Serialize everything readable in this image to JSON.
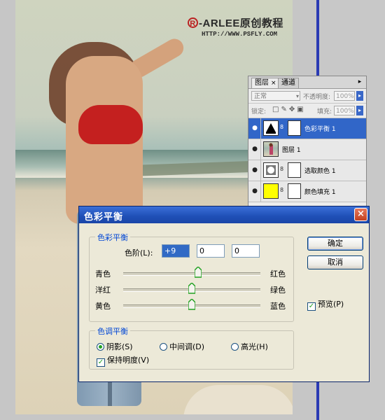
{
  "watermark": {
    "brand": "-ARLEE原创教程",
    "url": "HTTP://WWW.PSFLY.COM",
    "reg_symbol": "R"
  },
  "layers_panel": {
    "tabs": [
      {
        "label": "图层",
        "close": "×"
      },
      {
        "label": "通道"
      }
    ],
    "blend_mode": "正常",
    "opacity_label": "不透明度:",
    "opacity_value": "100%",
    "lock_label": "锁定:",
    "fill_label": "填充:",
    "fill_value": "100%",
    "layers": [
      {
        "name": "色彩平衡 1",
        "selected": true
      },
      {
        "name": "图层 1",
        "selected": false
      },
      {
        "name": "选取颜色 1",
        "selected": false
      },
      {
        "name": "颜色填充 1",
        "selected": false
      }
    ],
    "colors": {
      "selected": "#3166c8",
      "fill_swatch": "#ffff00"
    }
  },
  "dialog": {
    "title": "色彩平衡",
    "close_icon": "×",
    "balance_group": {
      "legend": "色彩平衡",
      "levels_label": "色阶(L):",
      "levels": [
        "+9",
        "0",
        "0"
      ],
      "sliders": [
        {
          "left": "青色",
          "right": "红色",
          "value": 9
        },
        {
          "left": "洋红",
          "right": "绿色",
          "value": 0
        },
        {
          "left": "黄色",
          "right": "蓝色",
          "value": 0
        }
      ]
    },
    "tone_group": {
      "legend": "色调平衡",
      "options": [
        {
          "label": "阴影(S)",
          "checked": true
        },
        {
          "label": "中间调(D)",
          "checked": false
        },
        {
          "label": "高光(H)",
          "checked": false
        }
      ],
      "preserve_luminosity": {
        "label": "保持明度(V)",
        "checked": true
      }
    },
    "ok_label": "确定",
    "cancel_label": "取消",
    "preview": {
      "label": "预览(P)",
      "checked": true
    }
  }
}
